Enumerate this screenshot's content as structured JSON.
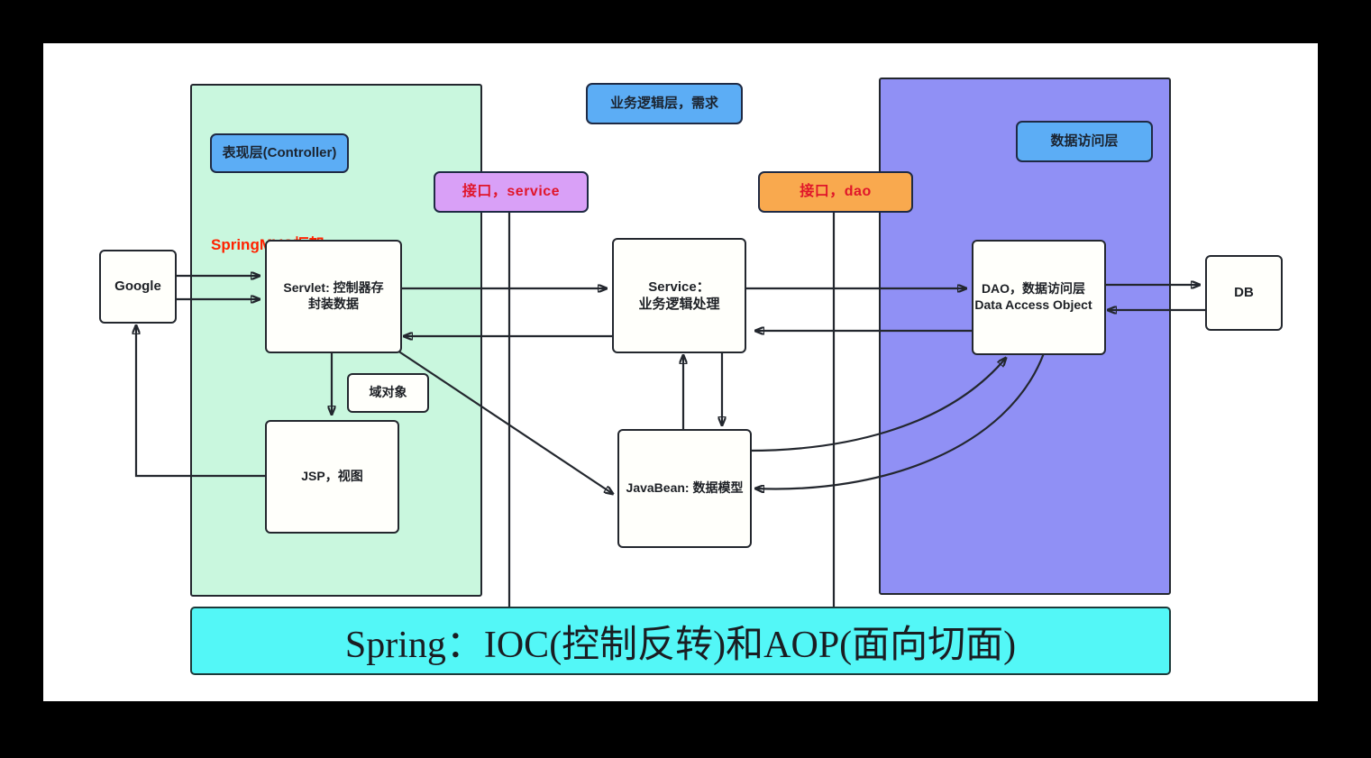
{
  "diagram": {
    "title_banner": "Spring：IOC(控制反转)和AOP(面向切面)",
    "layers": [
      {
        "id": "presentation",
        "tag": "表现层(Controller)",
        "note": "SpringMVC框架",
        "color": "#c9f7de",
        "tag_color": "#5cadf5"
      },
      {
        "id": "business",
        "tag": "业务逻辑层，需求",
        "color": "#ffffff",
        "tag_color": "#5cadf5"
      },
      {
        "id": "data-access",
        "tag": "数据访问层",
        "color": "#9090f5",
        "tag_color": "#5cadf5"
      }
    ],
    "interfaces": [
      {
        "id": "service",
        "label": "接口，service",
        "color": "#d9a0f7",
        "text_color": "#e0152a"
      },
      {
        "id": "dao",
        "label": "接口，dao",
        "color": "#f9a94e",
        "text_color": "#e0152a"
      }
    ],
    "nodes": {
      "google": "Google",
      "servlet_line1": "Servlet: 控制器存",
      "servlet_line2": "封装数据",
      "domain_object": "域对象",
      "jsp": "JSP，视图",
      "service_line1": "Service：",
      "service_line2": "业务逻辑处理",
      "javabean": "JavaBean: 数据模型",
      "dao_line1": "DAO，数据访问层",
      "dao_line2": "Data Access Object",
      "db": "DB"
    },
    "colors": {
      "presentation_layer": "#c9f7de",
      "data_layer": "#9090f5",
      "spring_banner": "#53f7f7",
      "tag_blue": "#5cadf5",
      "iface_service": "#d9a0f7",
      "iface_dao": "#f9a94e",
      "accent_red": "#ff2200",
      "stroke": "#23272e",
      "page": "#ffffff"
    }
  }
}
